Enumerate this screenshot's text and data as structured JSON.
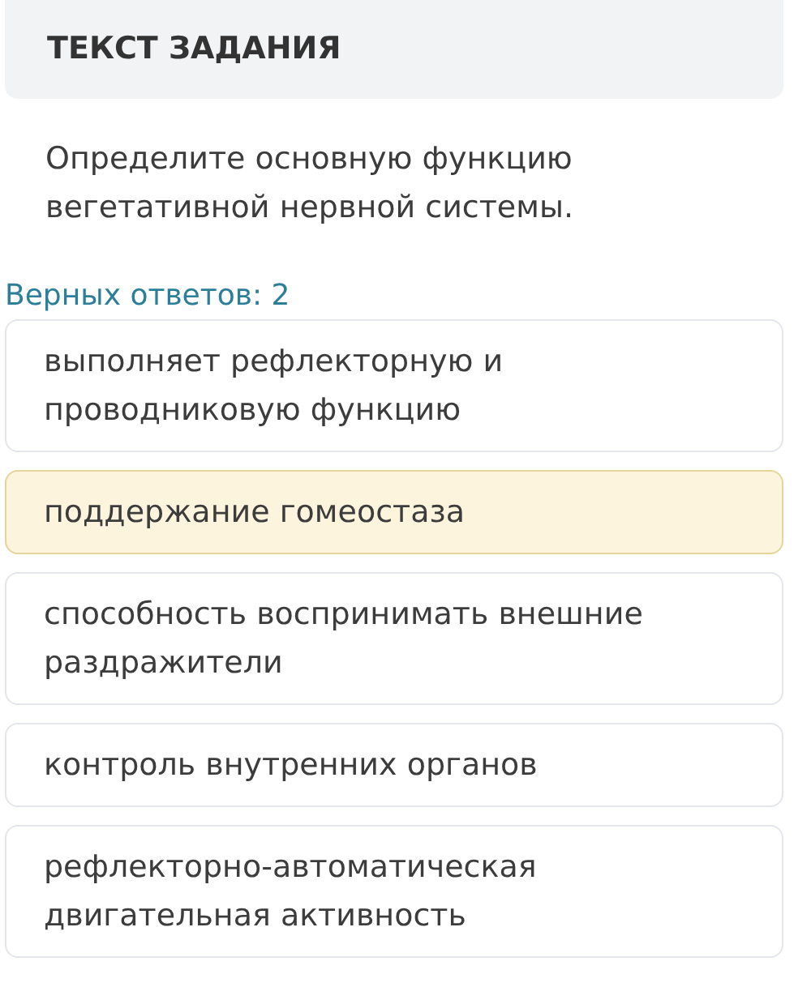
{
  "header": {
    "title": "ТЕКСТ ЗАДАНИЯ"
  },
  "question": "Определите основную функцию вегетативной нервной системы.",
  "answers_count": "Верных ответов: 2",
  "options": [
    {
      "label": "выполняет рефлекторную и проводниковую функцию",
      "selected": false
    },
    {
      "label": "поддержание гомеостаза",
      "selected": true
    },
    {
      "label": "способность воспринимать внешние раздражители",
      "selected": false
    },
    {
      "label": "контроль внутренних органов",
      "selected": false
    },
    {
      "label": "рефлекторно-автоматическая двигательная активность",
      "selected": false
    }
  ]
}
